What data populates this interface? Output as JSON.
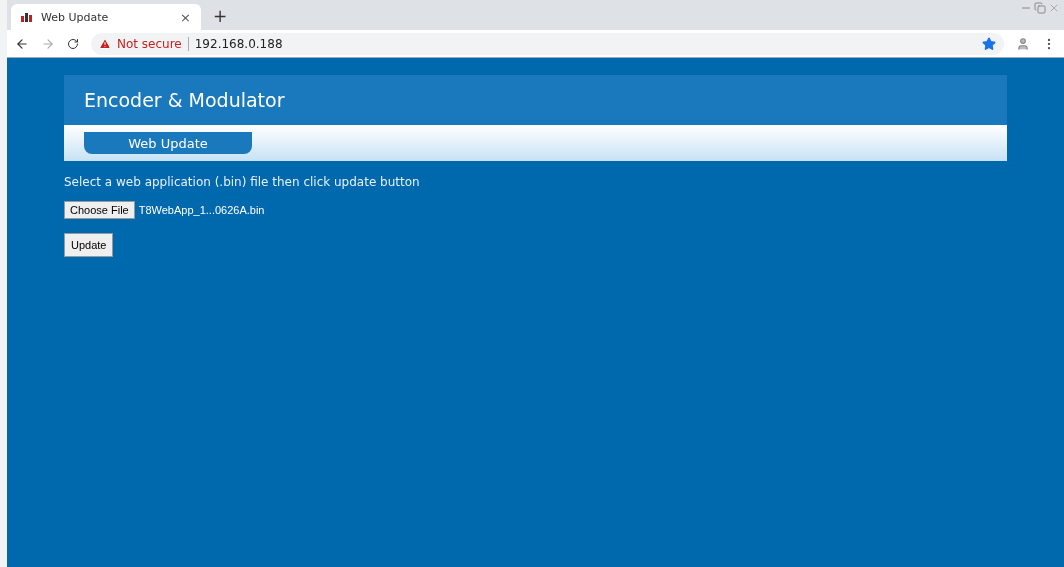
{
  "browser": {
    "tab": {
      "title": "Web Update",
      "close": "×",
      "selected": true
    },
    "new_tab": "+",
    "security": "Not secure",
    "url": "192.168.0.188"
  },
  "page": {
    "title": "Encoder & Modulator",
    "nav": [
      {
        "label": "Web Update",
        "selected": true
      }
    ],
    "instruction": "Select a web application (.bin) file then click update button",
    "file_button": "Choose File",
    "file_name": "T8WebApp_1...0626A.bin",
    "submit": "Update"
  }
}
